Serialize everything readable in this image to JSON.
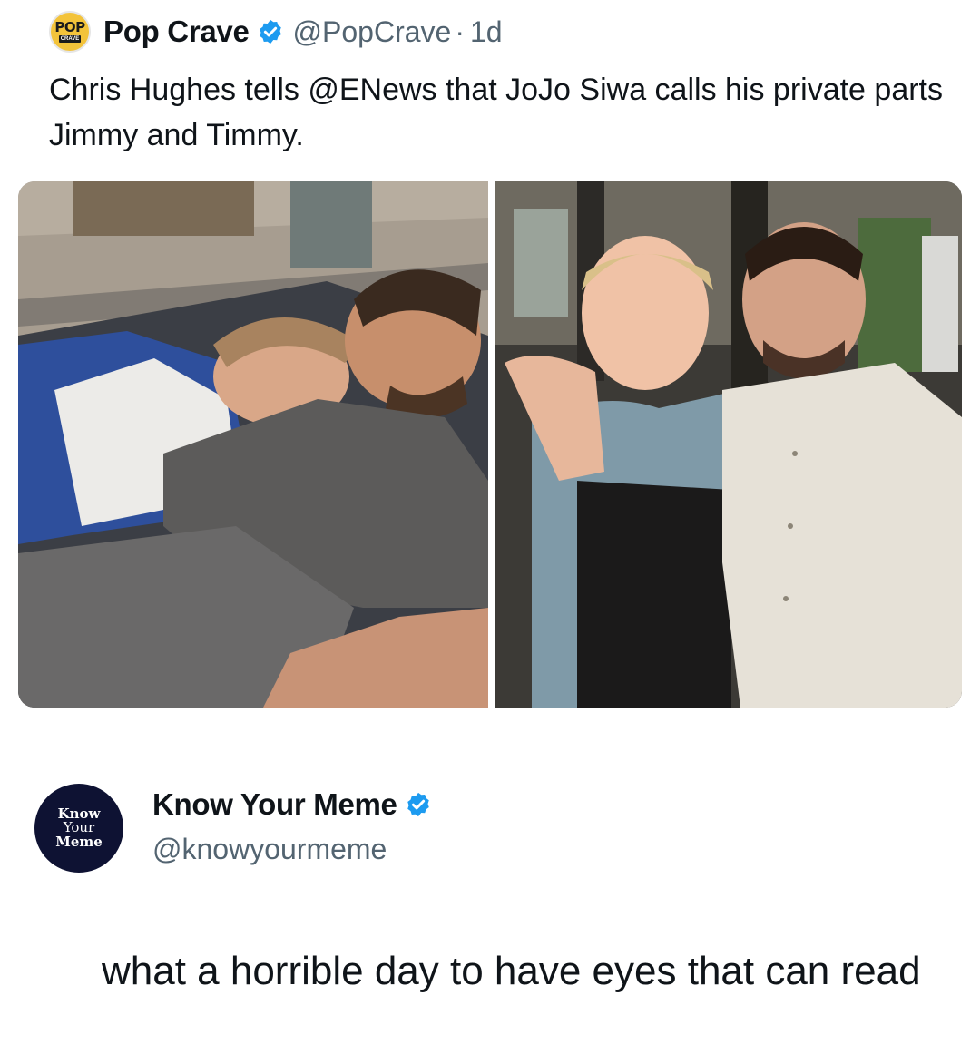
{
  "quoted_tweet": {
    "avatar": {
      "line1": "POP",
      "line2": "CRAVE"
    },
    "author_name": "Pop Crave",
    "handle": "@PopCrave",
    "separator": "·",
    "time": "1d",
    "text": "Chris Hughes tells @ENews that JoJo Siwa calls his private parts Jimmy and Timmy.",
    "images": [
      {
        "icon": "photo-lying-on-couch"
      },
      {
        "icon": "photo-posing-at-restaurant"
      }
    ]
  },
  "reply": {
    "avatar": {
      "line1": "Know",
      "line2": "Your",
      "line3": "Meme"
    },
    "author_name": "Know Your Meme",
    "handle": "@knowyourmeme",
    "text": "what a horrible day to have eyes that can read"
  },
  "colors": {
    "verified": "#1d9bf0",
    "secondary_text": "#536471",
    "kym_avatar_bg": "#0e1233",
    "popcrave_avatar_bg": "#f3c33a"
  }
}
